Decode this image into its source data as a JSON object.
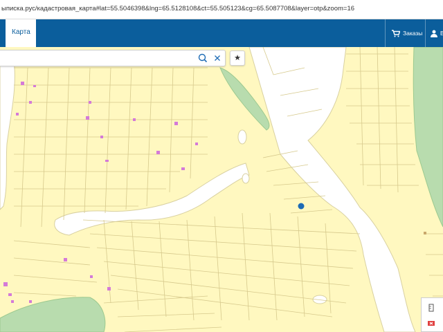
{
  "browser": {
    "url": "ыписка.рус/кадастровая_карта#lat=55.5046398&lng=65.5128108&ct=55.505123&cg=65.5087708&layer=otp&zoom=16"
  },
  "nav": {
    "active_tab": "Карта",
    "orders_label": "Заказы",
    "login_label": "В"
  },
  "search": {
    "value": "",
    "placeholder": ""
  },
  "icons": {
    "search": "search-icon",
    "clear": "close-icon",
    "favorite": "star-icon",
    "cart": "cart-icon",
    "user": "user-icon"
  },
  "colors": {
    "nav_bg": "#0b5e9c",
    "map_bg": "#fff8c0",
    "river": "#ffffff",
    "forest": "#b8dcae",
    "buildings": "#d47ad8",
    "marker": "#1d6bb5"
  }
}
